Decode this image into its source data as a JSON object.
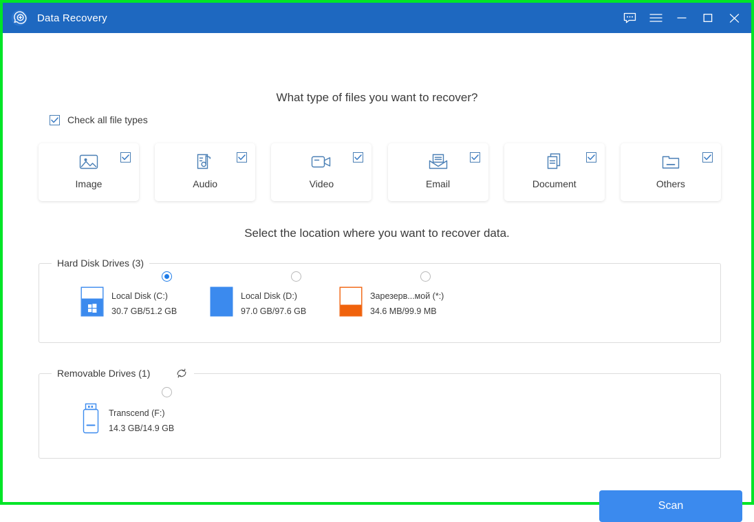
{
  "window": {
    "title": "Data Recovery",
    "logo_icon": "magnifier-plus-icon",
    "border_color": "#00e527",
    "titlebar_color": "#1e68c0",
    "controls": [
      {
        "name": "feedback-icon",
        "label": "Feedback"
      },
      {
        "name": "menu-icon",
        "label": "Menu"
      },
      {
        "name": "minimize-icon",
        "label": "Minimize"
      },
      {
        "name": "maximize-icon",
        "label": "Maximize"
      },
      {
        "name": "close-icon",
        "label": "Close"
      }
    ]
  },
  "filetypes": {
    "heading": "What type of files you want to recover?",
    "check_all_label": "Check all file types",
    "check_all_checked": true,
    "cards": [
      {
        "label": "Image",
        "icon": "image-icon",
        "checked": true
      },
      {
        "label": "Audio",
        "icon": "audio-icon",
        "checked": true
      },
      {
        "label": "Video",
        "icon": "video-icon",
        "checked": true
      },
      {
        "label": "Email",
        "icon": "email-icon",
        "checked": true
      },
      {
        "label": "Document",
        "icon": "document-icon",
        "checked": true
      },
      {
        "label": "Others",
        "icon": "folder-icon",
        "checked": true
      }
    ]
  },
  "location": {
    "heading": "Select the location where you want to recover data.",
    "hard_disk_group": {
      "legend": "Hard Disk Drives (3)",
      "drives": [
        {
          "name": "Local Disk (C:)",
          "size": "30.7 GB/51.2 GB",
          "selected": true,
          "fill_percent": 60,
          "fill_color": "#3b8aee",
          "icon": "windows-drive-icon"
        },
        {
          "name": "Local Disk (D:)",
          "size": "97.0 GB/97.6 GB",
          "selected": false,
          "fill_percent": 100,
          "fill_color": "#3b8aee",
          "icon": "drive-icon"
        },
        {
          "name": "Зарезерв...мой (*:)",
          "size": "34.6 MB/99.9 MB",
          "selected": false,
          "fill_percent": 40,
          "fill_color": "#f0620c",
          "icon": "drive-icon"
        }
      ]
    },
    "removable_group": {
      "legend": "Removable Drives (1)",
      "refresh_icon": "refresh-icon",
      "drives": [
        {
          "name": "Transcend (F:)",
          "size": "14.3 GB/14.9 GB",
          "selected": false,
          "icon": "usb-drive-icon"
        }
      ]
    }
  },
  "actions": {
    "scan_label": "Scan",
    "scan_color": "#3b8aee"
  }
}
